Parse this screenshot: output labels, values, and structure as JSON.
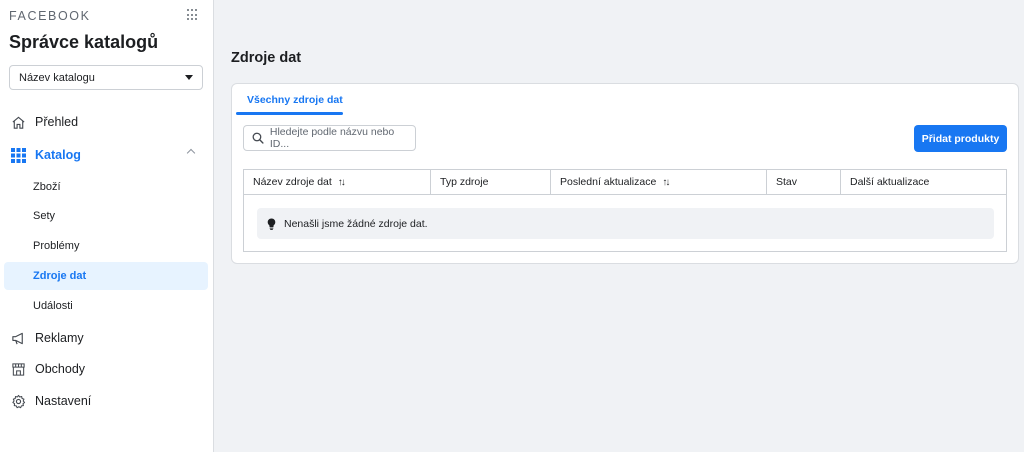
{
  "sidebar": {
    "brand": "FACEBOOK",
    "title": "Správce katalogů",
    "catalog_select": {
      "value": "Název katalogu"
    },
    "items": [
      {
        "label": "Přehled",
        "icon": "home-icon"
      },
      {
        "label": "Katalog",
        "icon": "grid-icon",
        "expanded": true
      },
      {
        "label": "Reklamy",
        "icon": "megaphone-icon"
      },
      {
        "label": "Obchody",
        "icon": "store-icon"
      },
      {
        "label": "Nastavení",
        "icon": "gear-icon"
      }
    ],
    "catalog_sub": [
      "Zboží",
      "Sety",
      "Problémy",
      "Zdroje dat",
      "Události"
    ],
    "selected_sub": "Zdroje dat"
  },
  "main": {
    "title": "Zdroje dat",
    "tab": "Všechny zdroje dat",
    "search_placeholder": "Hledejte podle názvu nebo ID...",
    "add_button": "Přidat produkty",
    "table": {
      "columns": [
        "Název zdroje dat",
        "Typ zdroje",
        "Poslední aktualizace",
        "Stav",
        "Další aktualizace"
      ],
      "sort_glyph": "↑↓",
      "empty_message": "Nenašli jsme žádné zdroje dat."
    }
  },
  "colors": {
    "accent": "#1877f2",
    "background": "#f0f2f5",
    "selected_bg": "#e7f3ff"
  }
}
